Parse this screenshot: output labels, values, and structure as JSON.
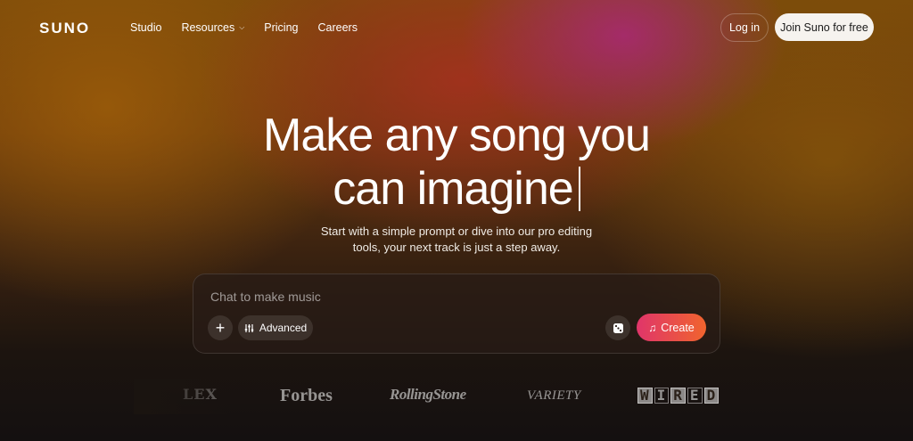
{
  "header": {
    "logo": "SUNO",
    "nav": [
      "Studio",
      "Resources",
      "Pricing",
      "Careers"
    ],
    "login": "Log in",
    "join": "Join Suno for free"
  },
  "hero": {
    "line1": "Make any song you",
    "line2": "can imagine",
    "sub1": "Start with a simple prompt or dive into our pro editing",
    "sub2": "tools, your next track is just a step away."
  },
  "prompt": {
    "placeholder": "Chat to make music",
    "advanced": "Advanced",
    "create": "Create"
  },
  "press": {
    "partial": "LEX",
    "forbes": "Forbes",
    "rolling": "RollingStone",
    "variety": "VARIETY",
    "wired": [
      "W",
      "I",
      "R",
      "E",
      "D"
    ]
  },
  "colors": {
    "create_start": "#e0356a",
    "create_end": "#f0642e"
  },
  "icons": [
    "chevron-down-icon",
    "plus-icon",
    "sliders-icon",
    "dice-icon",
    "music-note-icon"
  ]
}
